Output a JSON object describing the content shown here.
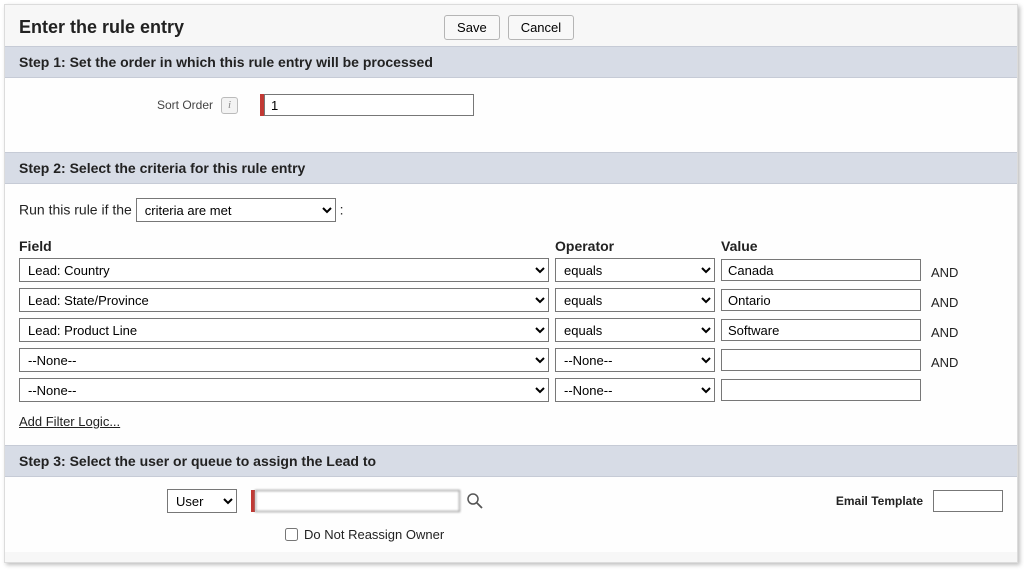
{
  "header": {
    "title": "Enter the rule entry",
    "save_label": "Save",
    "cancel_label": "Cancel"
  },
  "step1": {
    "heading": "Step 1: Set the order in which this rule entry will be processed",
    "sort_label": "Sort Order",
    "sort_value": "1"
  },
  "step2": {
    "heading": "Step 2: Select the criteria for this rule entry",
    "run_prefix": "Run this rule if the",
    "rule_mode_value": "criteria are met",
    "colon": ":",
    "headers": {
      "field": "Field",
      "operator": "Operator",
      "value": "Value"
    },
    "rows": [
      {
        "field": "Lead: Country",
        "operator": "equals",
        "value": "Canada",
        "conj": "AND"
      },
      {
        "field": "Lead: State/Province",
        "operator": "equals",
        "value": "Ontario",
        "conj": "AND"
      },
      {
        "field": "Lead: Product Line",
        "operator": "equals",
        "value": "Software",
        "conj": "AND"
      },
      {
        "field": "--None--",
        "operator": "--None--",
        "value": "",
        "conj": "AND"
      },
      {
        "field": "--None--",
        "operator": "--None--",
        "value": "",
        "conj": ""
      }
    ],
    "add_filter_label": "Add Filter Logic..."
  },
  "step3": {
    "heading": "Step 3: Select the user or queue to assign the Lead to",
    "assignee_type": "User",
    "assignee_name": "",
    "email_template_label": "Email Template",
    "email_template_value": "",
    "do_not_reassign_label": "Do Not Reassign Owner",
    "do_not_reassign_checked": false
  }
}
